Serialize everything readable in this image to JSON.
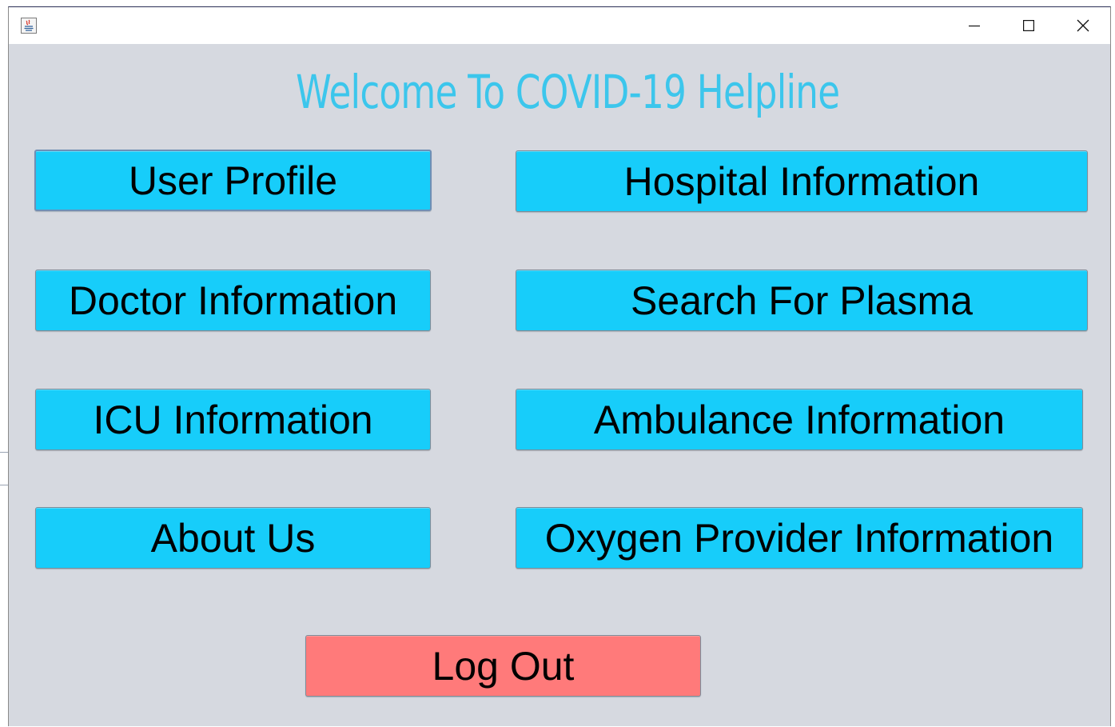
{
  "window": {
    "icon": "java-app-icon",
    "controls": {
      "minimize": "minimize-icon",
      "maximize": "maximize-icon",
      "close": "close-icon"
    }
  },
  "header": {
    "title": "Welcome To COVID-19 Helpline",
    "title_color": "#3cc6ec"
  },
  "menu": {
    "user_profile": "User Profile",
    "doctor_information": "Doctor Information",
    "icu_information": "ICU Information",
    "about_us": "About Us",
    "hospital_information": "Hospital Information",
    "search_for_plasma": "Search For Plasma",
    "ambulance_information": "Ambulance Information",
    "oxygen_provider_information": "Oxygen Provider Information",
    "log_out": "Log Out"
  },
  "colors": {
    "button": "#17cdfa",
    "logout_button": "#ff7a7a",
    "background": "#d6d9e0"
  }
}
